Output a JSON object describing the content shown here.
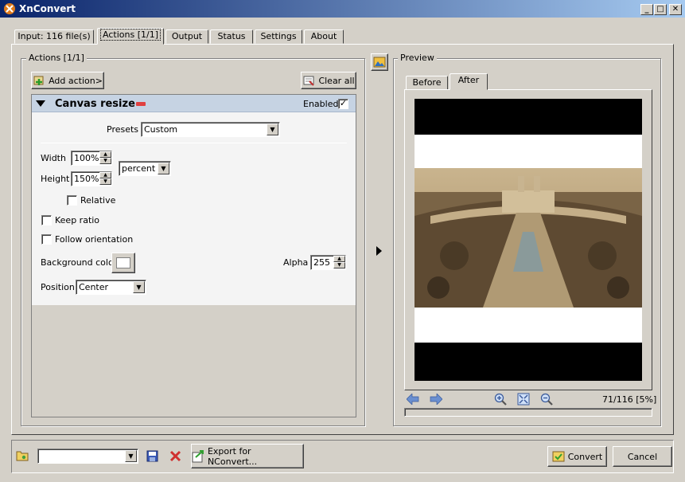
{
  "window": {
    "title": "XnConvert",
    "min": "_",
    "max": "□",
    "close": "✕"
  },
  "tabs": [
    "Input: 116 file(s)",
    "Actions [1/1]",
    "Output",
    "Status",
    "Settings",
    "About"
  ],
  "actions_panel": {
    "legend": "Actions [1/1]",
    "add_action_label": "Add action>",
    "clear_all_label": "Clear all",
    "action": {
      "title": "Canvas resize",
      "enabled_label": "Enabled",
      "enabled_check": "✓",
      "presets_label": "Presets",
      "presets_value": "Custom",
      "width_label": "Width",
      "width_value": "100%",
      "height_label": "Height",
      "height_value": "150%",
      "unit_value": "percent",
      "relative_label": "Relative",
      "keep_ratio_label": "Keep ratio",
      "follow_orientation_label": "Follow orientation",
      "background_color_label": "Background color",
      "alpha_label": "Alpha",
      "alpha_value": "255",
      "position_label": "Position",
      "position_value": "Center"
    }
  },
  "preview": {
    "legend": "Preview",
    "tabs": [
      "Before",
      "After"
    ],
    "counter": "71/116 [5%]"
  },
  "bottom": {
    "export_label": "Export for NConvert...",
    "convert_label": "Convert",
    "cancel_label": "Cancel"
  },
  "colors": {
    "title_start": "#0a246a",
    "title_end": "#a6caf0",
    "panel_bg": "#f4f4f4",
    "action_header": "#c6d3e3"
  }
}
